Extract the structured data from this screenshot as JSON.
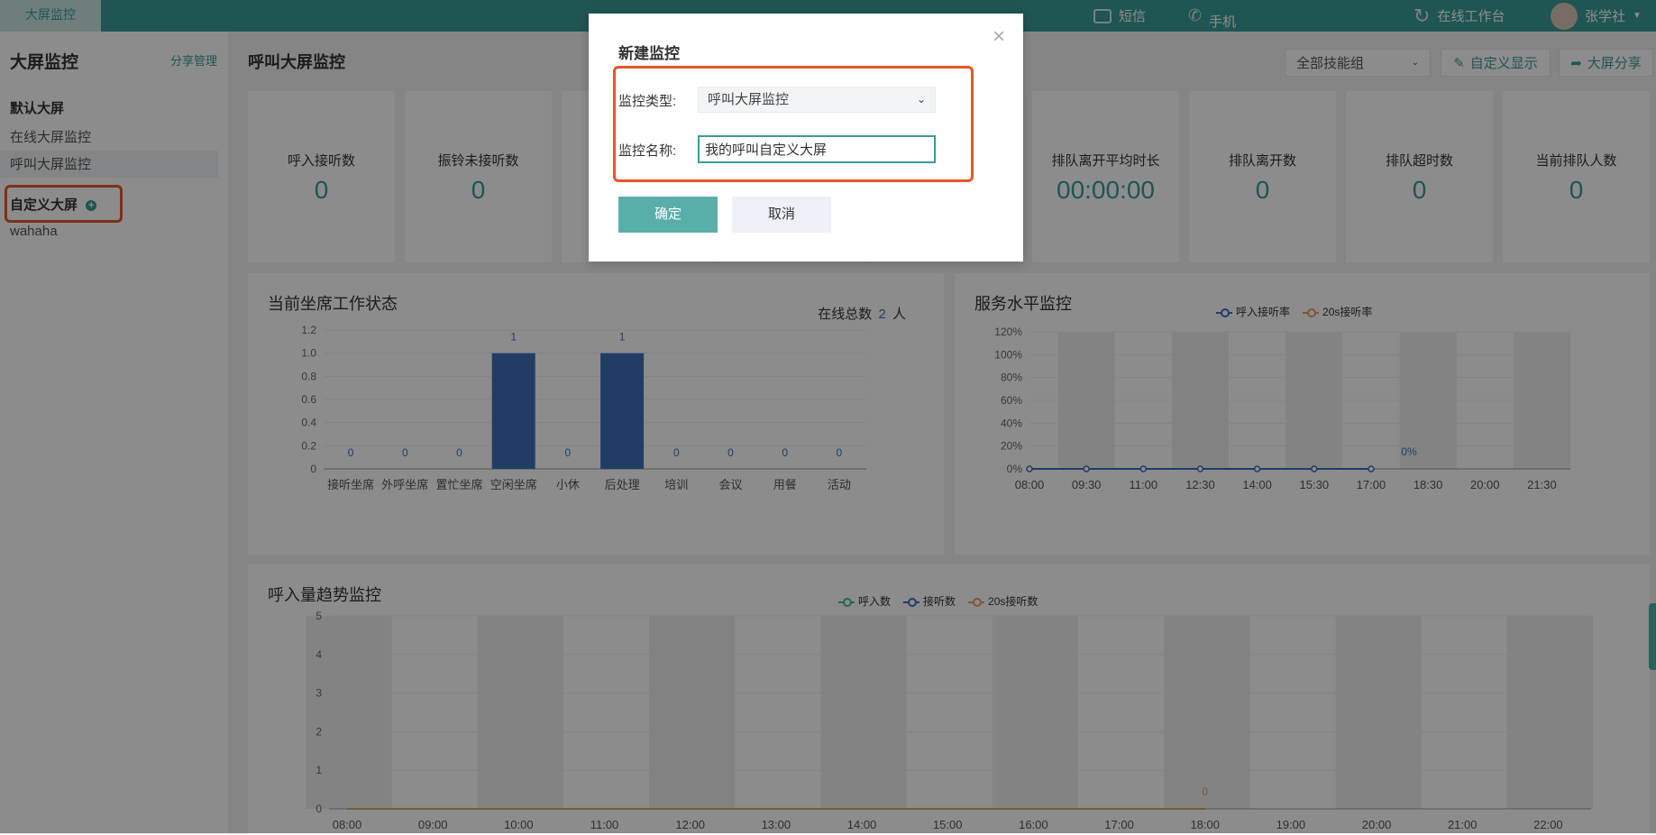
{
  "topbar": {
    "tab": "大屏监控",
    "sms": "短信",
    "phone_mode": "手机",
    "workbench": "在线工作台",
    "user": "张学社"
  },
  "sidebar": {
    "title": "大屏监控",
    "share": "分享管理",
    "default_header": "默认大屏",
    "default_items": [
      "在线大屏监控",
      "呼叫大屏监控"
    ],
    "custom_header": "自定义大屏",
    "custom_items": [
      "wahaha"
    ]
  },
  "main": {
    "title": "呼叫大屏监控",
    "skill_group": "全部技能组",
    "custom_display": "自定义显示",
    "share_screen": "大屏分享"
  },
  "stats": [
    {
      "label": "呼入接听数",
      "value": "0"
    },
    {
      "label": "振铃未接听数",
      "value": "0"
    },
    {
      "label": "排队离开平均时长",
      "value": "00:00:00"
    },
    {
      "label": "排队离开数",
      "value": "0"
    },
    {
      "label": "排队超时数",
      "value": "0"
    },
    {
      "label": "当前排队人数",
      "value": "0"
    }
  ],
  "agent_panel": {
    "title": "当前坐席工作状态",
    "online_prefix": "在线总数",
    "online_count": "2",
    "online_unit": "人"
  },
  "service_panel": {
    "title": "服务水平监控"
  },
  "trend_panel": {
    "title": "呼入量趋势监控"
  },
  "colors": {
    "brand": "#3a9c96",
    "bar": "#3c6fba",
    "orange": "#e0a060",
    "teal": "#48b3a6"
  },
  "chart_data": [
    {
      "type": "bar",
      "categories": [
        "接听坐席",
        "外呼坐席",
        "置忙坐席",
        "空闲坐席",
        "小休",
        "后处理",
        "培训",
        "会议",
        "用餐",
        "活动"
      ],
      "values": [
        0,
        0,
        0,
        1,
        0,
        1,
        0,
        0,
        0,
        0
      ],
      "yticks": [
        "0",
        "0.2",
        "0.4",
        "0.6",
        "0.8",
        "1.0",
        "1.2"
      ],
      "ylim": [
        0,
        1.2
      ]
    },
    {
      "type": "line",
      "categories": [
        "08:00",
        "09:30",
        "11:00",
        "12:30",
        "14:00",
        "15:30",
        "17:00",
        "18:30",
        "20:00",
        "21:30"
      ],
      "series": [
        {
          "name": "呼入接听率",
          "values": [
            0,
            0,
            0,
            0,
            0,
            0,
            0
          ]
        },
        {
          "name": "20s接听率",
          "values": []
        }
      ],
      "yticks": [
        "0%",
        "20%",
        "40%",
        "60%",
        "80%",
        "100%",
        "120%"
      ],
      "ylim": [
        0,
        120
      ],
      "point_label": "0%"
    },
    {
      "type": "line",
      "categories": [
        "08:00",
        "09:00",
        "10:00",
        "11:00",
        "12:00",
        "13:00",
        "14:00",
        "15:00",
        "16:00",
        "17:00",
        "18:00",
        "19:00",
        "20:00",
        "21:00",
        "22:00"
      ],
      "series": [
        {
          "name": "呼入数",
          "values": [
            0,
            0,
            0,
            0,
            0,
            0,
            0,
            0,
            0,
            0,
            0
          ]
        },
        {
          "name": "接听数",
          "values": [
            0,
            0,
            0,
            0,
            0,
            0,
            0,
            0,
            0,
            0,
            0
          ]
        },
        {
          "name": "20s接听数",
          "values": [
            0,
            0,
            0,
            0,
            0,
            0,
            0,
            0,
            0,
            0,
            0
          ]
        }
      ],
      "yticks": [
        "0",
        "1",
        "2",
        "3",
        "4",
        "5"
      ],
      "ylim": [
        0,
        5
      ],
      "point_label": "0"
    }
  ],
  "dialog": {
    "title": "新建监控",
    "type_label": "监控类型:",
    "type_value": "呼叫大屏监控",
    "name_label": "监控名称:",
    "name_value": "我的呼叫自定义大屏",
    "ok": "确定",
    "cancel": "取消",
    "close": "×"
  }
}
